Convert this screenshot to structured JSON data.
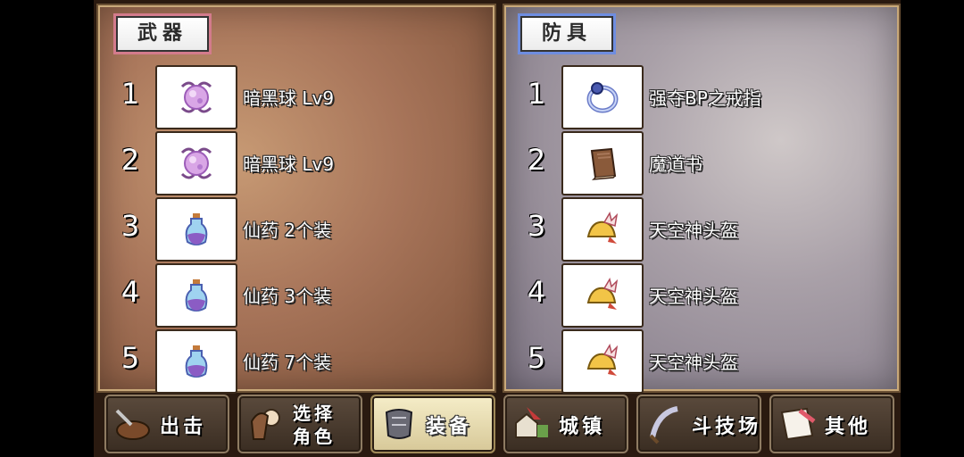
{
  "weapons": {
    "title": "武器",
    "items": [
      {
        "index": "1",
        "name": "暗黑球 Lv9",
        "icon": "dark-orb-icon"
      },
      {
        "index": "2",
        "name": "暗黑球 Lv9",
        "icon": "dark-orb-icon"
      },
      {
        "index": "3",
        "name": "仙药 2个装",
        "icon": "potion-icon"
      },
      {
        "index": "4",
        "name": "仙药 3个装",
        "icon": "potion-icon"
      },
      {
        "index": "5",
        "name": "仙药 7个装",
        "icon": "potion-icon"
      }
    ]
  },
  "armor": {
    "title": "防具",
    "items": [
      {
        "index": "1",
        "name": "强夺BP之戒指",
        "icon": "ring-icon"
      },
      {
        "index": "2",
        "name": "魔道书",
        "icon": "spellbook-icon"
      },
      {
        "index": "3",
        "name": "天空神头盔",
        "icon": "winged-helmet-icon"
      },
      {
        "index": "4",
        "name": "天空神头盔",
        "icon": "winged-helmet-icon"
      },
      {
        "index": "5",
        "name": "天空神头盔",
        "icon": "winged-helmet-icon"
      }
    ]
  },
  "nav": [
    {
      "label": "出击",
      "icon": "sortie-icon",
      "active": false
    },
    {
      "label_line1": "选择",
      "label_line2": "角色",
      "icon": "character-icon",
      "active": false
    },
    {
      "label": "装备",
      "icon": "armor-icon",
      "active": true
    },
    {
      "label": "城镇",
      "icon": "town-icon",
      "active": false
    },
    {
      "label": "斗技场",
      "icon": "arena-icon",
      "active": false
    },
    {
      "label": "其他",
      "icon": "other-icon",
      "active": false
    }
  ]
}
